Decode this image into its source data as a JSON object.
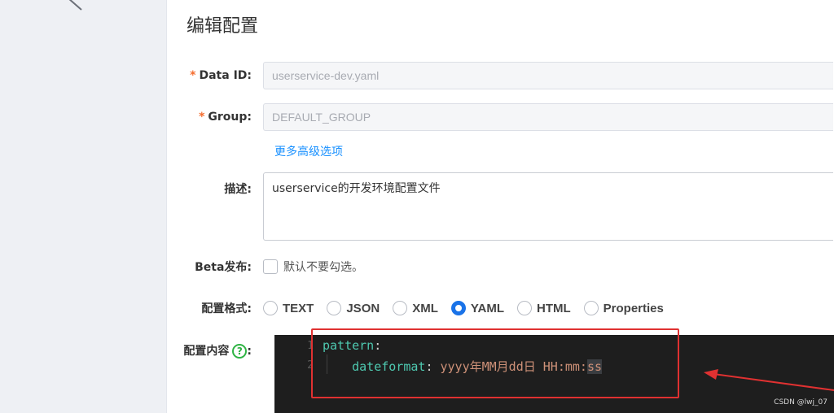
{
  "page": {
    "title": "编辑配置"
  },
  "form": {
    "data_id": {
      "label": "Data ID:",
      "required": "*",
      "value": "userservice-dev.yaml"
    },
    "group": {
      "label": "Group:",
      "required": "*",
      "value": "DEFAULT_GROUP"
    },
    "advanced_link": "更多高级选项",
    "description": {
      "label": "描述:",
      "value": "userservice的开发环境配置文件"
    },
    "beta": {
      "label": "Beta发布:",
      "checkbox_label": "默认不要勾选。"
    },
    "format": {
      "label": "配置格式:",
      "options": [
        "TEXT",
        "JSON",
        "XML",
        "YAML",
        "HTML",
        "Properties"
      ],
      "selected": "YAML"
    },
    "content": {
      "label": "配置内容",
      "help_glyph": "?",
      "lines": [
        {
          "number": "1",
          "key": "pattern",
          "sep": ":"
        },
        {
          "number": "2",
          "key": "dateformat",
          "sep": ": ",
          "value_pre": "yyyy年MM月dd日 HH:mm:",
          "value_sel": "ss"
        }
      ]
    }
  },
  "colors": {
    "accent": "#1a73e8",
    "required": "#f56c2e",
    "link": "#1890ff",
    "annotation": "#e03131",
    "editor_bg": "#1e1e1e"
  },
  "watermark": "CSDN @lwj_07"
}
